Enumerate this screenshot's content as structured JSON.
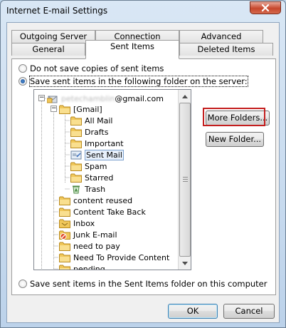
{
  "window": {
    "title": "Internet E-mail Settings",
    "close_icon": "close-icon"
  },
  "tabs": {
    "row_back": [
      "Outgoing Server",
      "Connection",
      "Advanced"
    ],
    "row_front": [
      "General",
      "Sent Items",
      "Deleted Items"
    ],
    "selected": "Sent Items"
  },
  "options": {
    "do_not_save": "Do not save copies of sent items",
    "save_on_server": "Save sent items in the following folder on the server:",
    "save_on_computer": "Save sent items in the Sent Items folder on this computer",
    "selected": "save_on_server"
  },
  "tree": {
    "account": "@gmail.com",
    "account_prefix_blurred": "petechamblin",
    "gmail_folder": "[Gmail]",
    "gmail_children": [
      "All Mail",
      "Drafts",
      "Important",
      "Sent Mail",
      "Spam",
      "Starred",
      "Trash"
    ],
    "root_folders": [
      "content reused",
      "Content Take Back",
      "Inbox",
      "Junk E-mail",
      "need to pay",
      "Need To Provide Content",
      "pending"
    ],
    "selected": "Sent Mail"
  },
  "buttons": {
    "more_folders": "More Folders...",
    "new_folder": "New Folder...",
    "ok": "OK",
    "cancel": "Cancel"
  },
  "colors": {
    "highlight_box": "#c41e1e",
    "selection": "#e7f0fb",
    "folder": "#f3cf6b"
  }
}
